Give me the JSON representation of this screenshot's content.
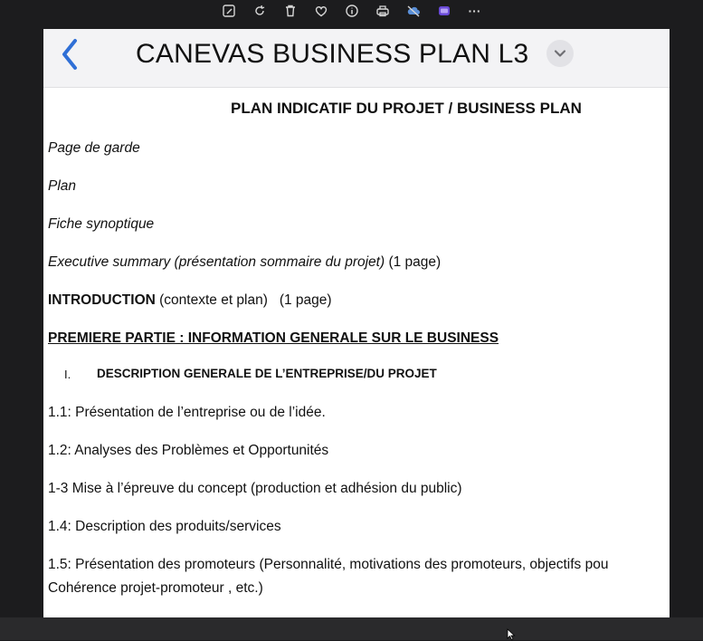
{
  "toolbar": {
    "icons": [
      "edit-image-icon",
      "rotate-icon",
      "trash-icon",
      "heart-icon",
      "info-icon",
      "print-icon",
      "cloud-icon",
      "clipchamp-icon",
      "more-icon"
    ],
    "more_label": "···"
  },
  "header": {
    "title": "CANEVAS BUSINESS PLAN L3",
    "back_icon": "chevron-left-icon",
    "dropdown_icon": "chevron-down-icon"
  },
  "document": {
    "heading": "PLAN INDICATIF DU PROJET / BUSINESS PLAN",
    "page_de_garde": "Page de garde",
    "plan": "Plan",
    "fiche": "Fiche synoptique",
    "exec_italic": "Executive summary (présentation sommaire du projet)",
    "exec_rest": " (1 page)",
    "intro_bold": "INTRODUCTION",
    "intro_rest": " (contexte et plan)   (1 page)",
    "partie1": "PREMIERE PARTIE : INFORMATION GENERALE SUR LE BUSINESS",
    "section_number": "I.",
    "section_title": "DESCRIPTION GENERALE DE L’ENTREPRISE/DU PROJET",
    "item_1_1": "1.1: Présentation de l’entreprise ou de l’idée.",
    "item_1_2": "1.2: Analyses des Problèmes et Opportunités",
    "item_1_3": "1-3 Mise à l’épreuve du concept (production et adhésion du public)",
    "item_1_4": "1.4: Description des produits/services",
    "item_1_5": "1.5: Présentation des promoteurs (Personnalité, motivations des promoteurs, objectifs pou",
    "item_1_5_cont": "Cohérence projet-promoteur , etc.)"
  },
  "colors": {
    "accent": "#2f6fd6",
    "background": "#1c1c1e",
    "page": "#ffffff",
    "header": "#f3f3f5"
  }
}
